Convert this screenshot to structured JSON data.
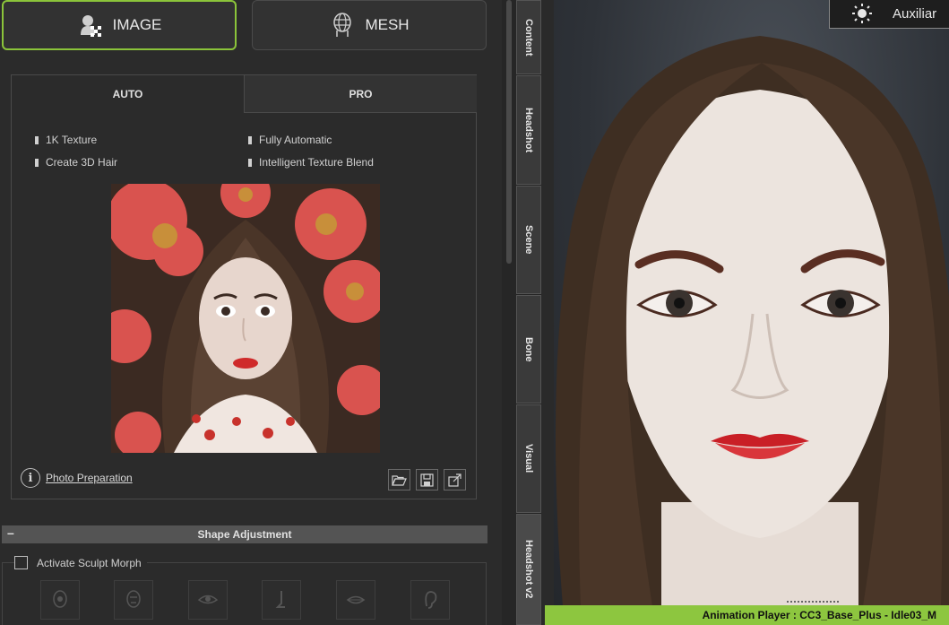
{
  "mode_buttons": {
    "image": "IMAGE",
    "mesh": "MESH",
    "accent": "#8bc43a"
  },
  "tabs": {
    "auto": "AUTO",
    "pro": "PRO"
  },
  "features": [
    "1K Texture",
    "Fully Automatic",
    "Create 3D Hair",
    "Intelligent Texture Blend"
  ],
  "photo_preparation": "Photo Preparation",
  "tool_buttons": [
    "open-folder-icon",
    "save-icon",
    "export-icon"
  ],
  "shape_adjustment": {
    "title": "Shape Adjustment",
    "collapse": "–"
  },
  "sculpt": {
    "label": "Activate Sculpt Morph",
    "checked": false
  },
  "morph_icons": [
    "head-morph-icon",
    "face-morph-icon",
    "eye-morph-icon",
    "nose-morph-icon",
    "mouth-morph-icon",
    "ear-morph-icon"
  ],
  "side_tabs": [
    "Content",
    "Headshot",
    "Scene",
    "Bone",
    "Visual",
    "Headshot v2"
  ],
  "viewport": {
    "aux_label": "Auxiliar"
  },
  "status": {
    "text": "Animation Player : CC3_Base_Plus - Idle03_M",
    "color": "#8dc63f"
  }
}
